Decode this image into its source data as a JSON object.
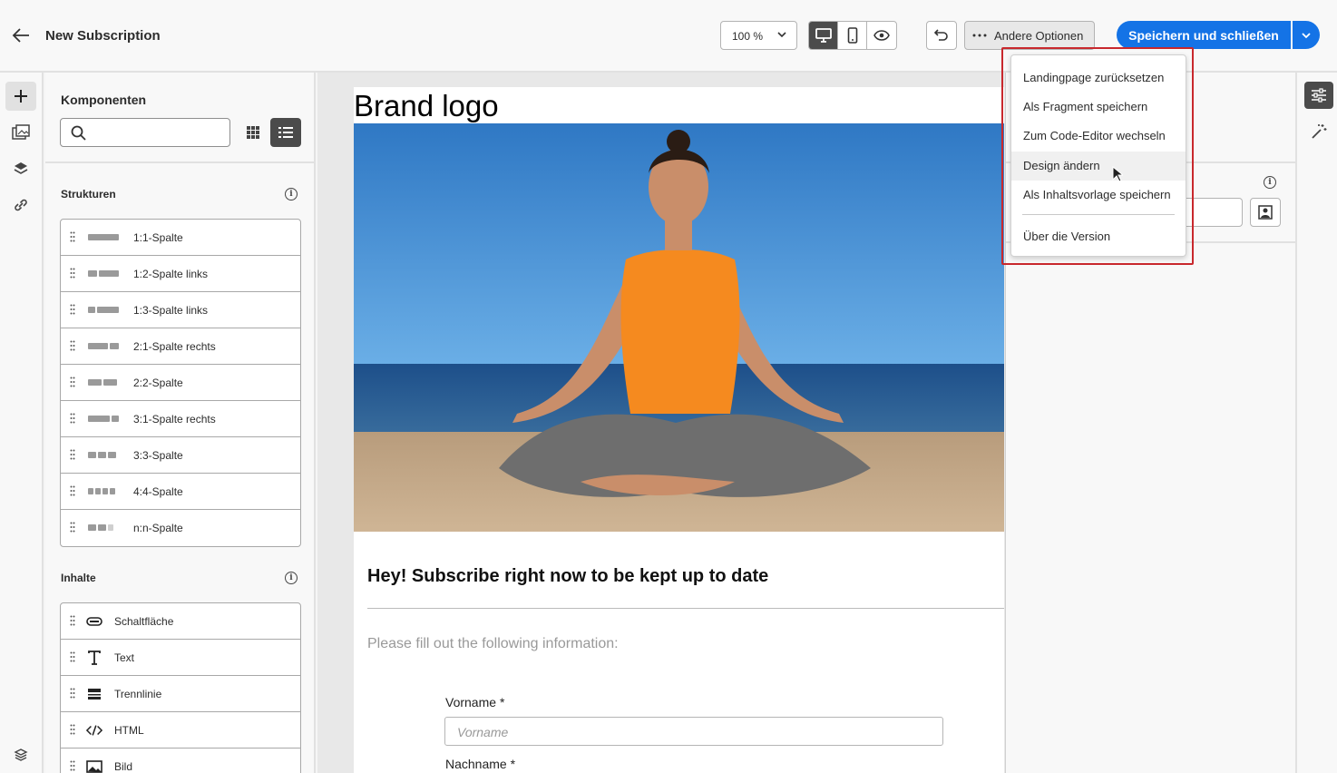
{
  "header": {
    "title": "New Subscription",
    "zoom": "100 %",
    "other_options": "Andere Optionen",
    "save_close": "Speichern und schließen"
  },
  "components": {
    "title": "Komponenten",
    "search_placeholder": "",
    "structures_title": "Strukturen",
    "structures": [
      "1:1-Spalte",
      "1:2-Spalte links",
      "1:3-Spalte links",
      "2:1-Spalte rechts",
      "2:2-Spalte",
      "3:1-Spalte rechts",
      "3:3-Spalte",
      "4:4-Spalte",
      "n:n-Spalte"
    ],
    "contents_title": "Inhalte",
    "contents": [
      "Schaltfläche",
      "Text",
      "Trennlinie",
      "HTML",
      "Bild"
    ]
  },
  "canvas": {
    "brand": "Brand logo",
    "headline": "Hey! Subscribe right now to be kept up to date",
    "subtext": "Please fill out the following information:",
    "first_name_label": "Vorname",
    "first_name_placeholder": "Vorname",
    "last_name_label": "Nachname",
    "required_mark": "*"
  },
  "menu": {
    "items": [
      "Landingpage zurücksetzen",
      "Als Fragment speichern",
      "Zum Code-Editor wechseln",
      "Design ändern",
      "Als Inhaltsvorlage speichern",
      "Über die Version"
    ],
    "hovered": "Design ändern"
  },
  "colors": {
    "accent": "#1473e6",
    "highlight": "#c8282d"
  }
}
